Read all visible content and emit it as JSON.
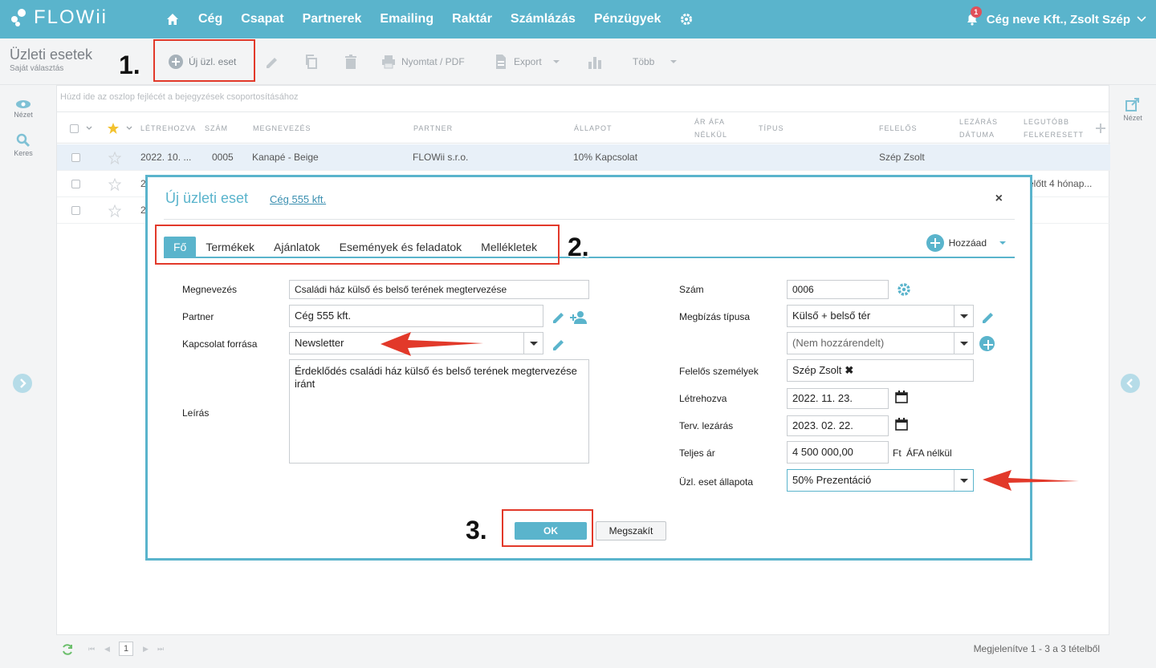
{
  "app": {
    "logo_text": "FLOWii",
    "nav": [
      "Cég",
      "Csapat",
      "Partnerek",
      "Emailing",
      "Raktár",
      "Számlázás",
      "Pénzügyek"
    ],
    "notification_count": "1",
    "user_label": "Cég neve Kft., Zsolt Szép",
    "accent_color": "#5ab4cc"
  },
  "toolbar": {
    "title": "Üzleti esetek",
    "subtitle": "Saját választás",
    "new_label": "Új üzl. eset",
    "print_label": "Nyomtat / PDF",
    "export_label": "Export",
    "more_label": "Több"
  },
  "left_rail": {
    "view_label": "Nézet",
    "search_label": "Keres"
  },
  "right_rail": {
    "view_label": "Nézet"
  },
  "grid": {
    "group_hint": "Húzd ide az oszlop fejlécét a bejegyzések csoportosításához",
    "columns": {
      "created": "LÉTREHOZVA",
      "number": "SZÁM",
      "name": "MEGNEVEZÉS",
      "partner": "PARTNER",
      "status": "ÁLLAPOT",
      "price_1": "ÁR ÁFA",
      "price_2": "NÉLKÜL",
      "type": "TÍPUS",
      "owner": "FELELŐS",
      "close_1": "LEZÁRÁS",
      "close_2": "DÁTUMA",
      "last_1": "LEGUTÓBB",
      "last_2": "FELKERESETT"
    },
    "rows": [
      {
        "created": "2022. 10. ...",
        "number": "0005",
        "name": "Kanapé - Beige",
        "partner": "FLOWii s.r.o.",
        "status": "10% Kapcsolat",
        "owner": "Szép Zsolt",
        "last": ""
      },
      {
        "created": "2",
        "number": "",
        "name": "",
        "partner": "",
        "status": "",
        "owner": "",
        "last": "előtt  4 hónap..."
      },
      {
        "created": "2",
        "number": "",
        "name": "",
        "partner": "",
        "status": "",
        "owner": "",
        "last": ""
      }
    ],
    "page": "1",
    "footer_info": "Megjelenítve 1 - 3 a 3 tételből"
  },
  "modal": {
    "title": "Új üzleti eset",
    "company_link": "Cég 555 kft.",
    "close": "×",
    "tabs": [
      "Fő",
      "Termékek",
      "Ajánlatok",
      "Események és feladatok",
      "Mellékletek"
    ],
    "add_label": "Hozzáad",
    "left": {
      "name_label": "Megnevezés",
      "name_value": "Családi ház külső és belső terének megtervezése",
      "partner_label": "Partner",
      "partner_value": "Cég 555 kft.",
      "source_label": "Kapcsolat forrása",
      "source_value": "Newsletter",
      "desc_label": "Leírás",
      "desc_value": "Érdeklődés családi ház külső és belső terének megtervezése iránt"
    },
    "right": {
      "number_label": "Szám",
      "number_value": "0006",
      "type_label": "Megbízás típusa",
      "type_value": "Külső + belső tér",
      "type2_value": "(Nem hozzárendelt)",
      "owners_label": "Felelős személyek",
      "owner_tag": "Szép Zsolt",
      "owner_tag_x": "✖",
      "created_label": "Létrehozva",
      "created_value": "2022. 11. 23.",
      "close_label": "Terv. lezárás",
      "close_value": "2023. 02. 22.",
      "price_label": "Teljes ár",
      "price_value": "4 500 000,00",
      "price_currency": "Ft",
      "price_suffix": "ÁFA nélkül",
      "status_label": "Üzl. eset állapota",
      "status_value": "50% Prezentáció"
    },
    "ok_label": "OK",
    "cancel_label": "Megszakít"
  },
  "annotations": {
    "step1": "1.",
    "step2": "2.",
    "step3": "3.",
    "color": "#e2392a"
  }
}
